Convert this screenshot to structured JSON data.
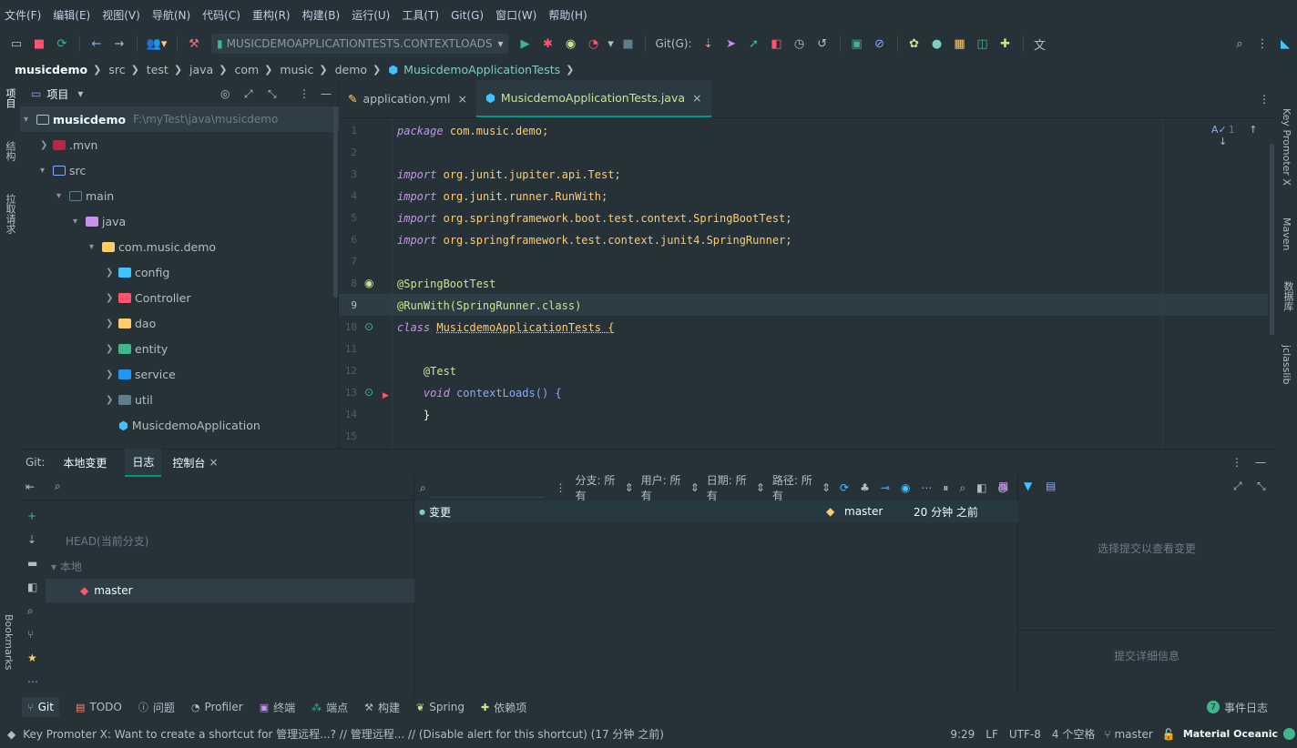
{
  "menu": [
    "文件(F)",
    "编辑(E)",
    "视图(V)",
    "导航(N)",
    "代码(C)",
    "重构(R)",
    "构建(B)",
    "运行(U)",
    "工具(T)",
    "Git(G)",
    "窗口(W)",
    "帮助(H)"
  ],
  "toolbar": {
    "run_config": "MUSICDEMOAPPLICATIONTESTS.CONTEXTLOADS",
    "git_label": "Git(G):"
  },
  "breadcrumb": [
    "musicdemo",
    "src",
    "test",
    "java",
    "com",
    "music",
    "demo",
    "MusicdemoApplicationTests"
  ],
  "left_tabs": [
    "项目",
    "结构",
    "拉取请求",
    "Bookmarks"
  ],
  "right_tabs": [
    "Key Promoter X",
    "Maven",
    "数据库",
    "jclasslib"
  ],
  "project": {
    "header": "项目",
    "root_name": "musicdemo",
    "root_path": "F:\\myTest\\java\\musicdemo",
    "items": [
      ".mvn",
      "src",
      "main",
      "java",
      "com.music.demo",
      "config",
      "Controller",
      "dao",
      "entity",
      "service",
      "util",
      "MusicdemoApplication"
    ]
  },
  "editor": {
    "tabs": [
      "application.yml",
      "MusicdemoApplicationTests.java"
    ],
    "inspection_count": "1",
    "line_numbers": [
      "1",
      "2",
      "3",
      "4",
      "5",
      "6",
      "7",
      "8",
      "9",
      "10",
      "11",
      "12",
      "13",
      "14",
      "15"
    ],
    "lines": [
      "package com.music.demo;",
      "",
      "import org.junit.jupiter.api.Test;",
      "import org.junit.runner.RunWith;",
      "import org.springframework.boot.test.context.SpringBootTest;",
      "import org.springframework.test.context.junit4.SpringRunner;",
      "",
      "@SpringBootTest",
      "@RunWith(SpringRunner.class)",
      "class MusicdemoApplicationTests {",
      "",
      "    @Test",
      "    void contextLoads() {",
      "    }",
      ""
    ]
  },
  "bottom": {
    "tabs": [
      "Git:",
      "本地变更",
      "日志",
      "控制台"
    ],
    "head": "HEAD(当前分支)",
    "local": "本地",
    "branch": "master",
    "filters": [
      "分支: 所有",
      "用户: 所有",
      "日期: 所有",
      "路径: 所有"
    ],
    "commit_msg": "变更",
    "commit_branch": "master",
    "commit_time": "20 分钟 之前",
    "select_hint": "选择提交以查看变更",
    "detail_hint": "提交详细信息"
  },
  "toolwindows": [
    "Git",
    "TODO",
    "问题",
    "Profiler",
    "终端",
    "端点",
    "构建",
    "Spring",
    "依赖项"
  ],
  "event_log": {
    "count": "7",
    "label": "事件日志"
  },
  "status": {
    "message": "Key Promoter X: Want to create a shortcut for 管理远程...? // 管理远程... // (Disable alert for this shortcut) (17 分钟 之前)",
    "pos": "9:29",
    "eol": "LF",
    "enc": "UTF-8",
    "indent": "4 个空格",
    "branch": "master",
    "theme": "Material Oceanic"
  }
}
